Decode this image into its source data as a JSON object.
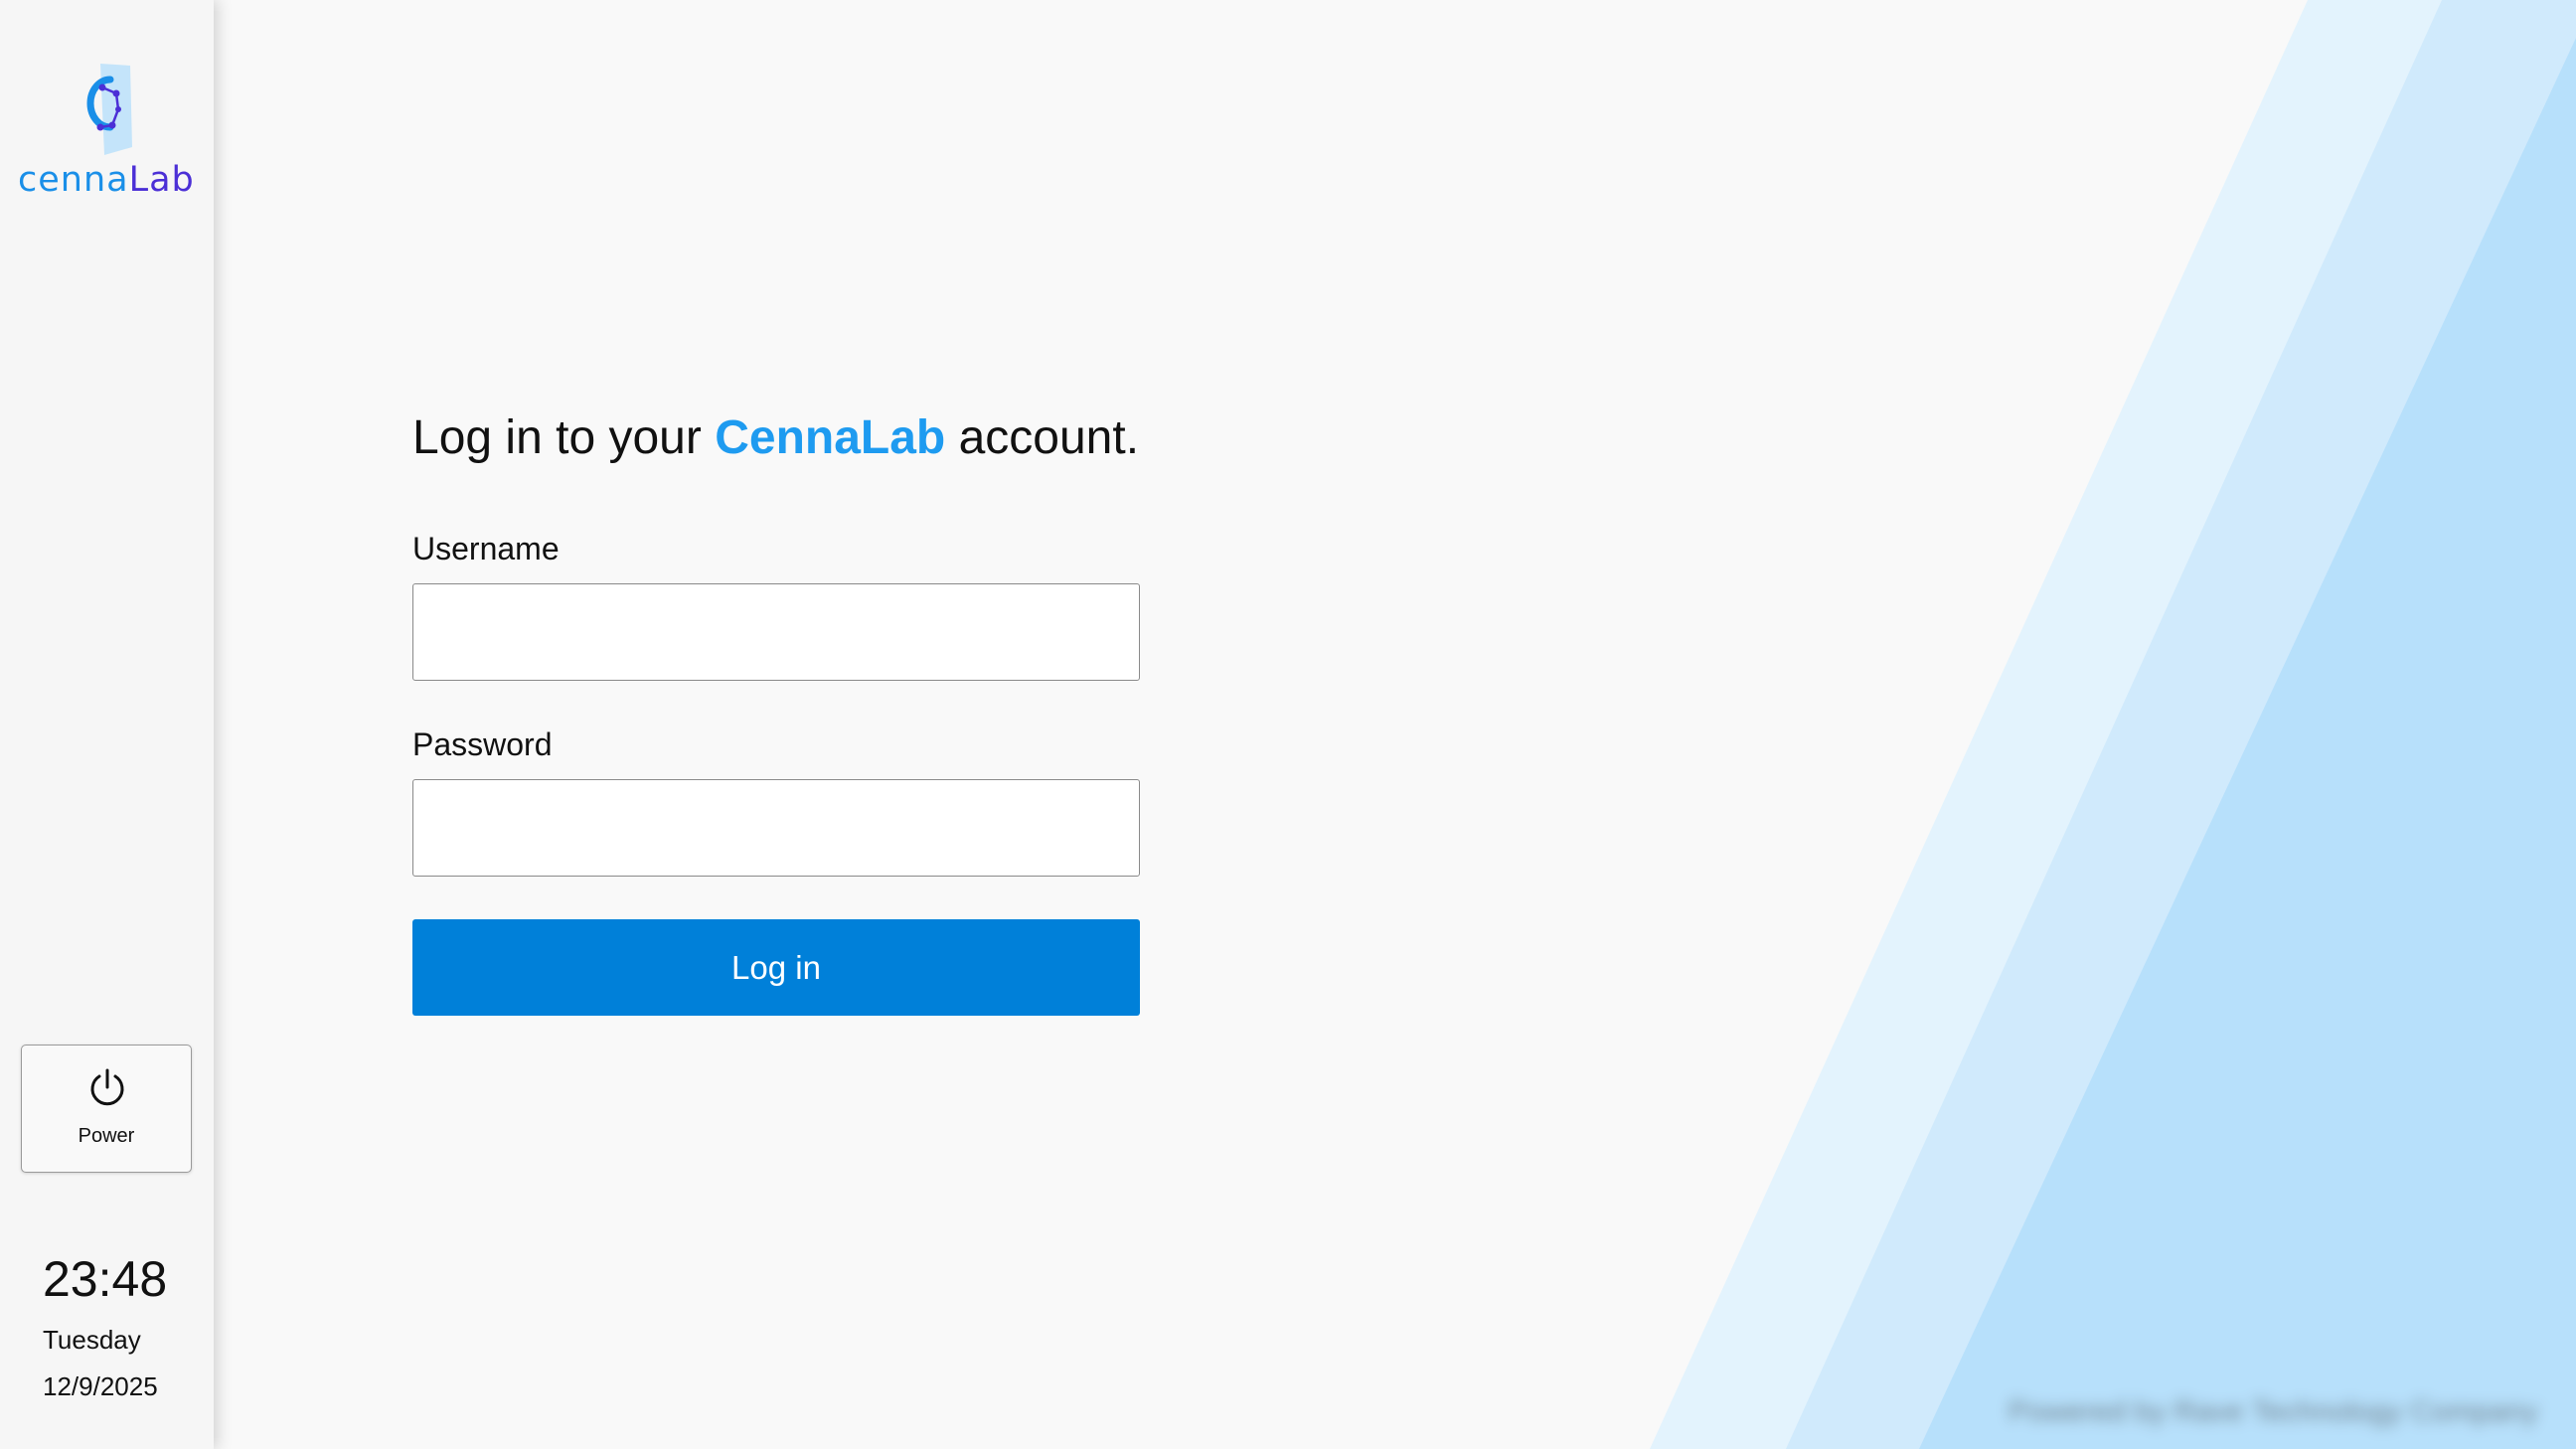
{
  "app": {
    "logo_text_part1": "cenna",
    "logo_text_part2": "Lab",
    "logo_icon": "cennalab-logo-icon"
  },
  "sidebar": {
    "power_button": {
      "label": "Power",
      "icon": "power-icon"
    },
    "clock": {
      "time": "23:48",
      "day": "Tuesday",
      "date": "12/9/2025"
    }
  },
  "login": {
    "heading_prefix": "Log in to your ",
    "heading_brand": "CennaLab",
    "heading_suffix": " account.",
    "username": {
      "label": "Username",
      "value": "",
      "placeholder": ""
    },
    "password": {
      "label": "Password",
      "value": "",
      "placeholder": ""
    },
    "submit_label": "Log in"
  },
  "footer": {
    "credit_text": "Powered by Rave Technology Company"
  },
  "colors": {
    "brand_blue": "#1e9bf0",
    "button_blue": "#0080d9",
    "logo_purple": "#4b2fd6",
    "stripe_light": "#e3f3fd",
    "stripe_mid": "#d0eafc",
    "stripe_dark": "#b7e0fb"
  }
}
